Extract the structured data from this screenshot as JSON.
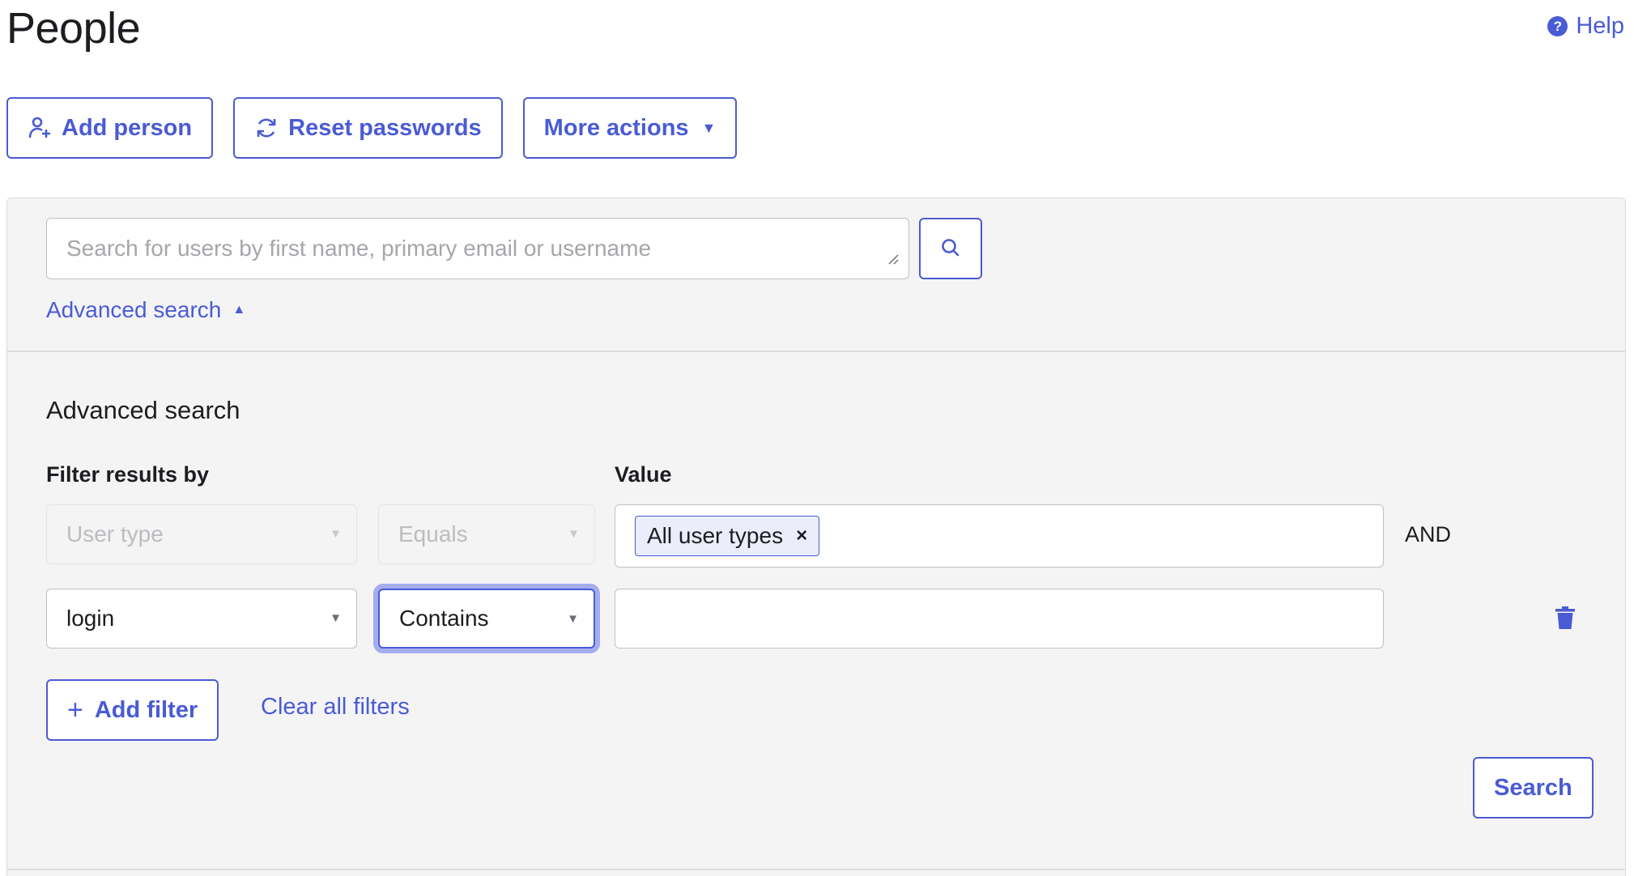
{
  "page": {
    "title": "People",
    "help_label": "Help"
  },
  "toolbar": {
    "add_person_label": "Add person",
    "reset_passwords_label": "Reset passwords",
    "more_actions_label": "More actions"
  },
  "search": {
    "placeholder": "Search for users by first name, primary email or username",
    "value": "",
    "advanced_toggle_label": "Advanced search"
  },
  "advanced": {
    "title": "Advanced search",
    "filter_label": "Filter results by",
    "value_label": "Value",
    "filters": [
      {
        "field": "User type",
        "operator": "Equals",
        "value_chip": "All user types",
        "joiner": "AND",
        "disabled": true
      },
      {
        "field": "login",
        "operator": "Contains",
        "value": "",
        "disabled": false
      }
    ],
    "add_filter_label": "Add filter",
    "clear_filters_label": "Clear all filters",
    "search_button_label": "Search"
  },
  "icons": {
    "help": "help-circle-icon",
    "add_person": "user-plus-icon",
    "reset": "refresh-icon",
    "dropdown": "caret-down-icon",
    "search": "magnifier-icon",
    "remove": "close-icon",
    "delete": "trash-icon",
    "add": "plus-icon"
  },
  "colors": {
    "accent": "#4a5bd5",
    "panel_bg": "#f4f4f4",
    "focus_ring": "#a4aded",
    "chip_bg": "#ebedfb"
  }
}
